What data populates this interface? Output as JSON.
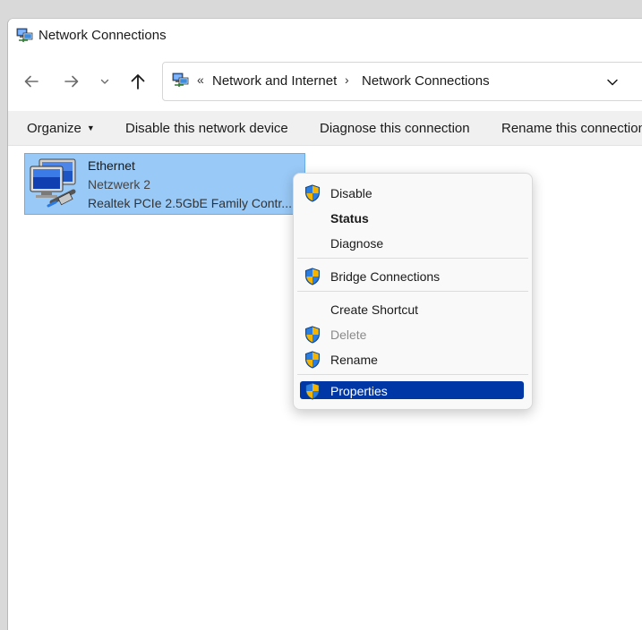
{
  "window": {
    "title": "Network Connections"
  },
  "address": {
    "overflow": "«",
    "crumbs": [
      "Network and Internet",
      "Network Connections"
    ],
    "separator": "›"
  },
  "commandbar": {
    "organize": "Organize",
    "disable": "Disable this network device",
    "diagnose": "Diagnose this connection",
    "rename": "Rename this connection"
  },
  "item": {
    "name": "Ethernet",
    "network": "Netzwerk 2",
    "adapter": "Realtek PCIe 2.5GbE Family Contr..."
  },
  "context_menu": {
    "items": [
      {
        "label": "Disable",
        "shield": true
      },
      {
        "label": "Status",
        "bold": true
      },
      {
        "label": "Diagnose"
      },
      {
        "label": "Bridge Connections",
        "shield": true
      },
      {
        "label": "Create Shortcut"
      },
      {
        "label": "Delete",
        "shield": true,
        "disabled": true
      },
      {
        "label": "Rename",
        "shield": true
      },
      {
        "label": "Properties",
        "shield": true,
        "selected": true
      }
    ]
  },
  "colors": {
    "selection_fill": "#99c9f7",
    "menu_highlight": "#0037a6",
    "commandbar_bg": "#f0f0f0"
  },
  "icons": {
    "app": "network-connections-icon",
    "back": "back-arrow-icon",
    "forward": "forward-arrow-icon",
    "recent": "chevron-down-icon",
    "up": "up-arrow-icon",
    "adapter": "ethernet-adapter-icon",
    "uac": "uac-shield-icon"
  }
}
